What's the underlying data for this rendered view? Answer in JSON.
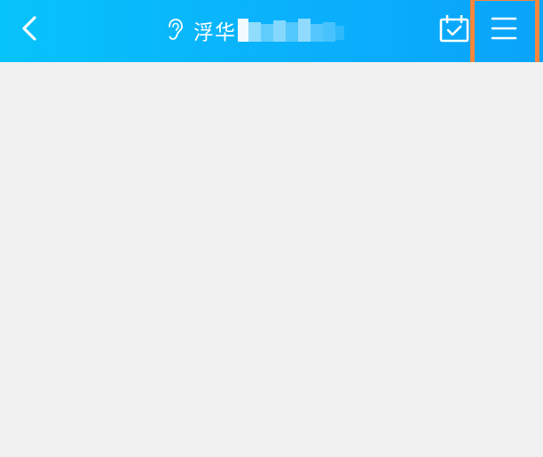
{
  "header": {
    "title": "浮华",
    "background_color": "#0ab0fb",
    "back_icon": "chevron-left-icon",
    "ear_icon": "ear-icon",
    "calendar_icon": "calendar-check-icon",
    "menu_icon": "hamburger-menu-icon"
  },
  "annotation": {
    "highlight_color": "#f7873a"
  },
  "content": {
    "background_color": "#f1f1f1"
  }
}
